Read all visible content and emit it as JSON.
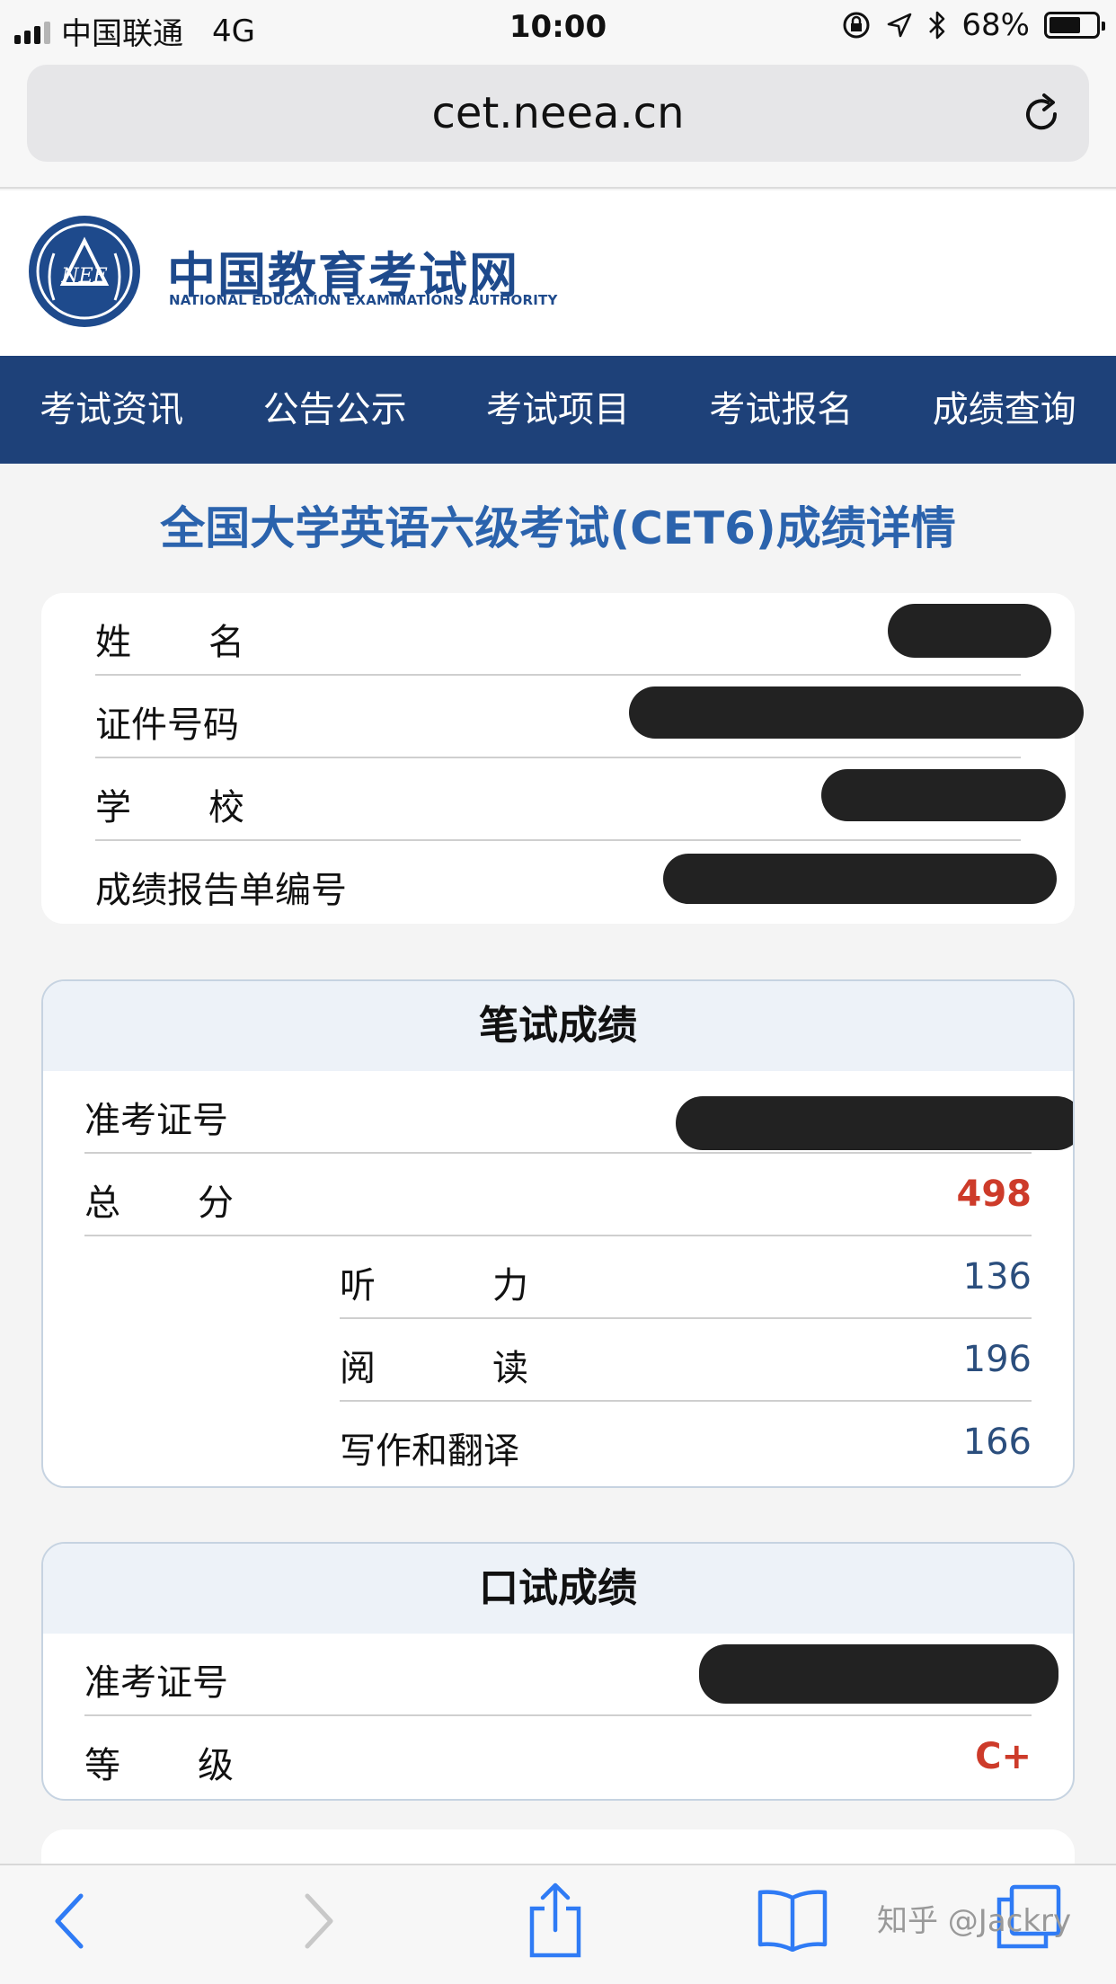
{
  "status_bar": {
    "carrier": "中国联通",
    "network": "4G",
    "time": "10:00",
    "battery": "68%",
    "battery_level": 0.68
  },
  "browser": {
    "url": "cet.neea.cn"
  },
  "site": {
    "name_cn": "中国教育考试网",
    "name_en": "NATIONAL EDUCATION EXAMINATIONS AUTHORITY",
    "seal_text": "NEE"
  },
  "nav": [
    "考试资讯",
    "公告公示",
    "考试项目",
    "考试报名",
    "成绩查询"
  ],
  "page_title": "全国大学英语六级考试(CET6)成绩详情",
  "candidate": {
    "name_label": "姓名",
    "id_label": "证件号码",
    "school_label": "学校",
    "report_label": "成绩报告单编号"
  },
  "written": {
    "heading": "笔试成绩",
    "ticket_label": "准考证号",
    "total_label": "总分",
    "total": "498",
    "listening_label": "听力",
    "listening": "136",
    "reading_label": "阅读",
    "reading": "196",
    "writing_label": "写作和翻译",
    "writing": "166"
  },
  "oral": {
    "heading": "口试成绩",
    "ticket_label": "准考证号",
    "grade_label": "等级",
    "grade": "C+"
  },
  "watermark": "知乎 @Jackry",
  "colors": {
    "nav_bg": "#1e4179",
    "title_blue": "#2b63ad",
    "score_red": "#cd3b2a",
    "score_blue": "#2b4e7d"
  },
  "icons": [
    "reload-icon",
    "back-icon",
    "forward-icon",
    "share-icon",
    "bookmarks-icon",
    "tabs-icon",
    "location-icon",
    "bluetooth-icon",
    "rotation-lock-icon"
  ]
}
